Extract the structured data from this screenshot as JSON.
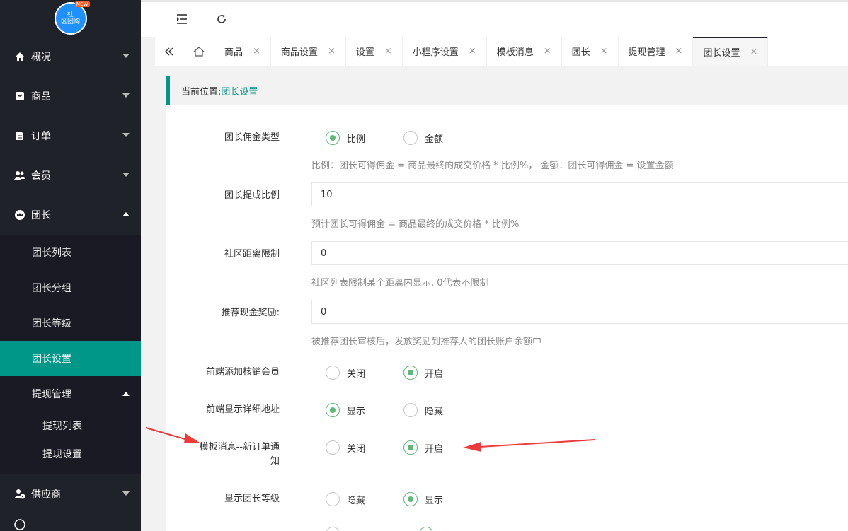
{
  "sidebar": {
    "logo": {
      "line1": "社",
      "line2": "区团购",
      "badge": "NEW"
    },
    "menu": [
      {
        "label": "概况",
        "icon": "home-icon"
      },
      {
        "label": "商品",
        "icon": "goods-icon"
      },
      {
        "label": "订单",
        "icon": "order-icon"
      },
      {
        "label": "会员",
        "icon": "member-icon"
      },
      {
        "label": "团长",
        "icon": "leader-icon"
      }
    ],
    "leader_sub": [
      "团长列表",
      "团长分组",
      "团长等级",
      "团长设置"
    ],
    "withdraw_group": "提现管理",
    "withdraw_sub": [
      "提现列表",
      "提现设置"
    ],
    "supplier": {
      "label": "供应商",
      "icon": "supplier-icon"
    }
  },
  "tabs": [
    {
      "label": "商品"
    },
    {
      "label": "商品设置"
    },
    {
      "label": "设置"
    },
    {
      "label": "小程序设置"
    },
    {
      "label": "模板消息"
    },
    {
      "label": "团长"
    },
    {
      "label": "提现管理"
    },
    {
      "label": "团长设置"
    }
  ],
  "tab_close": "×",
  "breadcrumb": {
    "prefix": "当前位置:",
    "current": "团长设置"
  },
  "form": {
    "commission_type": {
      "label": "团长佣金类型",
      "options": [
        "比例",
        "金额"
      ],
      "selected": "比例",
      "hint": "比例：团长可得佣金 = 商品最终的成交价格 * 比例%， 金额：团长可得佣金 = 设置金额"
    },
    "commission_rate": {
      "label": "团长提成比例",
      "value": "10",
      "hint": "预计团长可得佣金 = 商品最终的成交价格 * 比例%"
    },
    "distance_limit": {
      "label": "社区距离限制",
      "value": "0",
      "hint": "社区列表限制某个距离内显示, 0代表不限制"
    },
    "referral_reward": {
      "label": "推荐现金奖励:",
      "value": "0",
      "hint": "被推荐团长审核后，发放奖励到推荐人的团长账户余额中"
    },
    "frontend_add_verifier": {
      "label": "前端添加核销会员",
      "options": [
        "关闭",
        "开启"
      ],
      "selected": "开启"
    },
    "frontend_show_address": {
      "label": "前端显示详细地址",
      "options": [
        "显示",
        "隐藏"
      ],
      "selected": "显示"
    },
    "template_new_order": {
      "label_line1": "模板消息--新订单通",
      "label_line2": "知",
      "options": [
        "关闭",
        "开启"
      ],
      "selected": "开启"
    },
    "show_leader_level": {
      "label": "显示团长等级",
      "options": [
        "隐藏",
        "显示"
      ],
      "selected": "显示"
    }
  },
  "colors": {
    "accent": "#009688",
    "radio": "#5FB878",
    "sidebar": "#20222a",
    "annotation": "#ee3a3a"
  }
}
